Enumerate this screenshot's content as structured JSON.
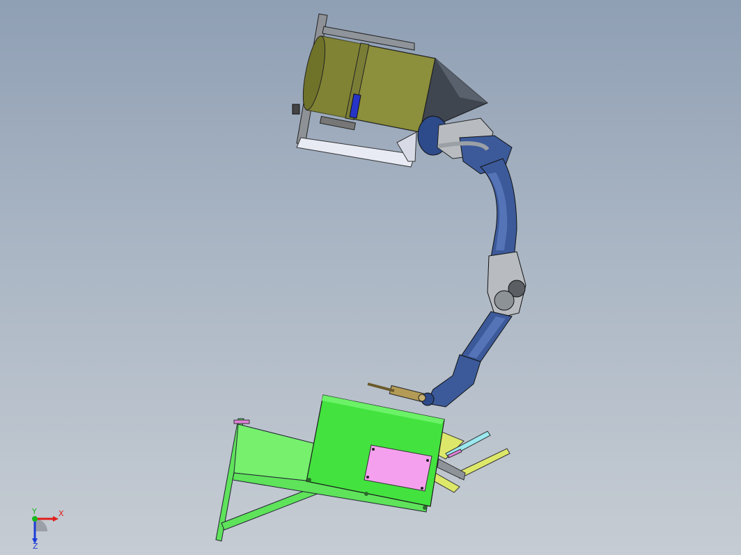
{
  "viewport": {
    "background_top": "#8f9fb4",
    "background_bottom": "#c6ccd3"
  },
  "colors": {
    "hopper_body": "#8c8f3b",
    "hopper_cone": "#3f4650",
    "robot_arm": "#3c5a9a",
    "robot_joint": "#b8bcc0",
    "fixture_green": "#5ee35a",
    "fixture_light_green": "#76f06d",
    "panel_pink": "#f5a0ee",
    "yellow_parts": "#dde86a",
    "cyan_parts": "#9be8ef"
  },
  "triad": {
    "x_label": "X",
    "y_label": "Y",
    "z_label": "Z",
    "x_color": "#e0201c",
    "y_color": "#19b81b",
    "z_color": "#1c3cd8"
  }
}
